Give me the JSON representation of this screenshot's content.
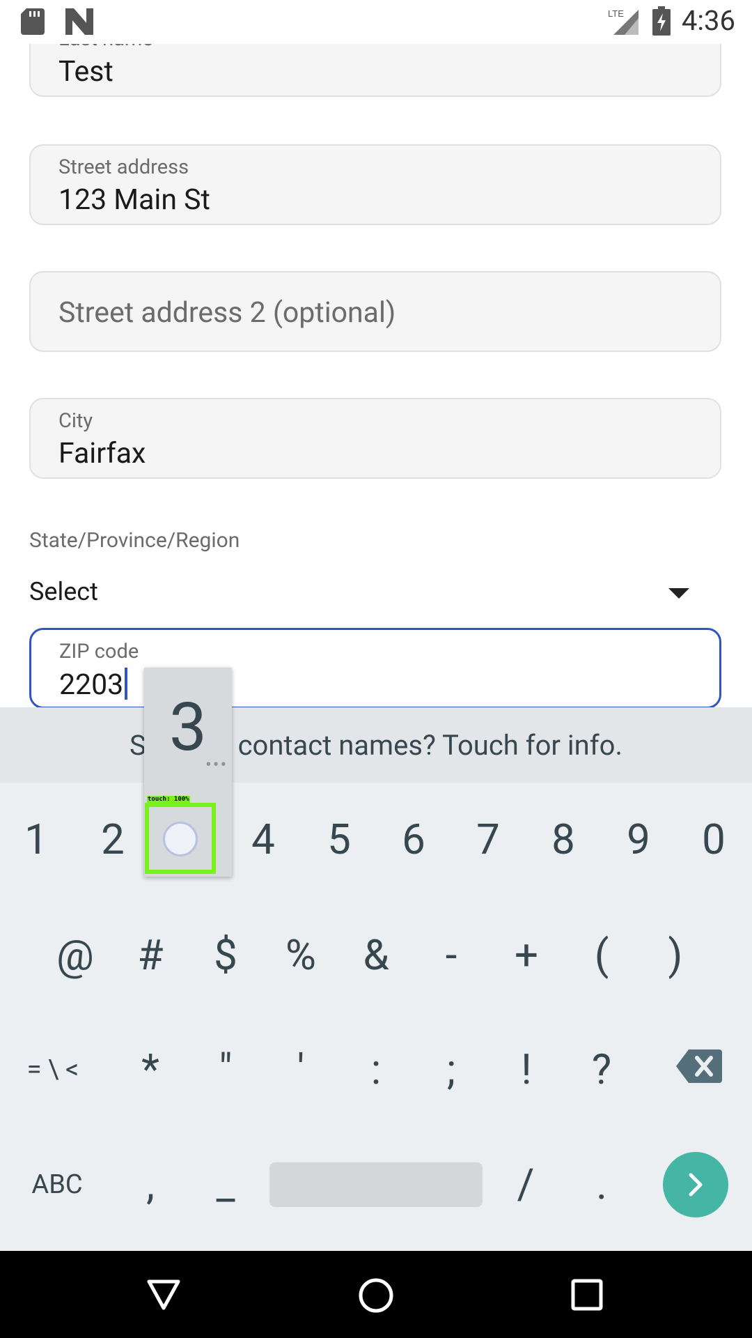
{
  "status_bar": {
    "time": "4:36",
    "network": "LTE"
  },
  "form": {
    "last_name": {
      "label": "Last name",
      "value": "Test"
    },
    "street": {
      "label": "Street address",
      "value": "123 Main St"
    },
    "street2": {
      "placeholder": "Street address 2 (optional)"
    },
    "city": {
      "label": "City",
      "value": "Fairfax"
    },
    "state": {
      "label": "State/Province/Region",
      "value": "Select"
    },
    "zip": {
      "label": "ZIP code",
      "value": "2203"
    }
  },
  "keyboard": {
    "suggestion": "Suggest contact names? Touch for info.",
    "preview_key": "3",
    "row1": [
      "1",
      "2",
      "3",
      "4",
      "5",
      "6",
      "7",
      "8",
      "9",
      "0"
    ],
    "row2": [
      "@",
      "#",
      "$",
      "%",
      "&",
      "-",
      "+",
      "(",
      ")"
    ],
    "row3": [
      "= \\ <",
      "*",
      "\"",
      "'",
      ":",
      ";",
      "!",
      "?"
    ],
    "row4": [
      "ABC",
      ",",
      "_",
      "/",
      "."
    ]
  },
  "touch_overlay": {
    "label": "touch: 100%"
  },
  "colors": {
    "accent": "#2d55c5",
    "enter": "#45b6a5",
    "touch_box": "#7cf01a",
    "keyboard_bg": "#eceff1"
  }
}
